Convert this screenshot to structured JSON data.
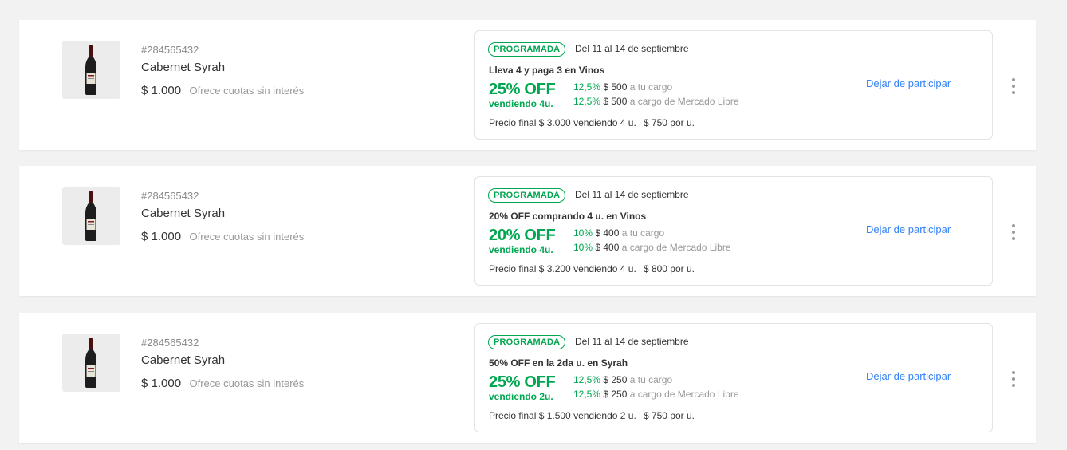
{
  "offers": [
    {
      "item": {
        "id": "#284565432",
        "title": "Cabernet Syrah",
        "price": "$ 1.000",
        "installments": "Ofrece cuotas sin interés",
        "image_icon": "wine-bottle-icon"
      },
      "promo": {
        "status": "PROGRAMADA",
        "dates": "Del 11 al 14 de septiembre",
        "name": "Lleva 4 y paga 3 en Vinos",
        "discount": "25% OFF",
        "condition": "vendiendo 4u.",
        "seller_share": {
          "pct": "12,5%",
          "amount": "$ 500",
          "label": "a tu cargo"
        },
        "ml_share": {
          "pct": "12,5%",
          "amount": "$ 500",
          "label": "a cargo de Mercado Libre"
        },
        "final_price": "Precio final $ 3.000 vendiendo 4 u.",
        "unit_price": "$ 750 por u."
      },
      "action": "Dejar de participar"
    },
    {
      "item": {
        "id": "#284565432",
        "title": "Cabernet Syrah",
        "price": "$ 1.000",
        "installments": "Ofrece cuotas sin interés",
        "image_icon": "wine-bottle-icon"
      },
      "promo": {
        "status": "PROGRAMADA",
        "dates": "Del 11 al 14 de septiembre",
        "name": "20% OFF comprando 4 u. en Vinos",
        "discount": "20% OFF",
        "condition": "vendiendo 4u.",
        "seller_share": {
          "pct": "10%",
          "amount": "$ 400",
          "label": "a tu cargo"
        },
        "ml_share": {
          "pct": "10%",
          "amount": "$ 400",
          "label": "a cargo de Mercado Libre"
        },
        "final_price": "Precio final $ 3.200 vendiendo 4 u.",
        "unit_price": "$ 800 por u."
      },
      "action": "Dejar de participar"
    },
    {
      "item": {
        "id": "#284565432",
        "title": "Cabernet Syrah",
        "price": "$ 1.000",
        "installments": "Ofrece cuotas sin interés",
        "image_icon": "wine-bottle-icon"
      },
      "promo": {
        "status": "PROGRAMADA",
        "dates": "Del 11 al 14 de septiembre",
        "name": "50% OFF en la 2da u. en Syrah",
        "discount": "25% OFF",
        "condition": "vendiendo 2u.",
        "seller_share": {
          "pct": "12,5%",
          "amount": "$ 250",
          "label": "a tu cargo"
        },
        "ml_share": {
          "pct": "12,5%",
          "amount": "$ 250",
          "label": "a cargo de Mercado Libre"
        },
        "final_price": "Precio final $ 1.500 vendiendo 2 u.",
        "unit_price": "$ 750 por u."
      },
      "action": "Dejar de participar"
    }
  ],
  "colors": {
    "accent_green": "#00a650",
    "link_blue": "#3483fa",
    "background": "#f2f2f2"
  }
}
